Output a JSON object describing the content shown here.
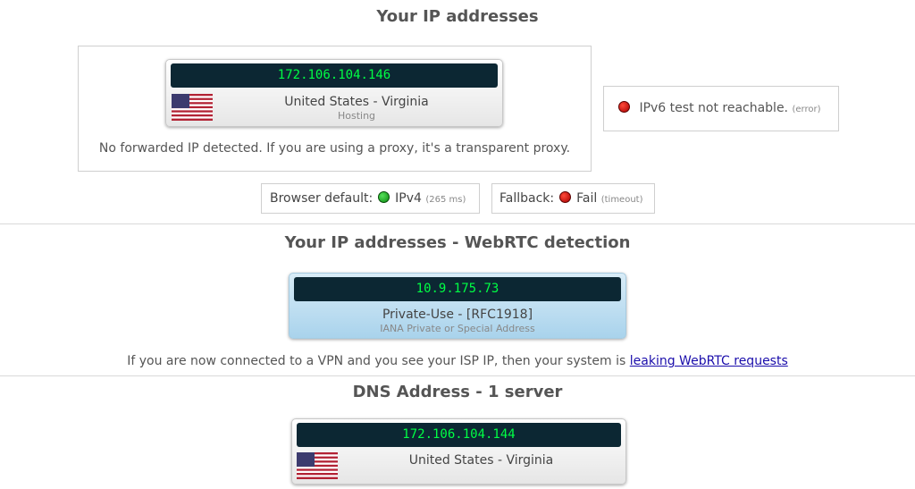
{
  "ip_section": {
    "title": "Your IP addresses",
    "ip": "172.106.104.146",
    "location": "United States - Virginia",
    "type": "Hosting",
    "forward_note": "No forwarded IP detected. If you are using a proxy, it's a transparent proxy.",
    "ipv6": {
      "text": "IPv6 test not reachable.",
      "detail": "(error)",
      "status_color": "#cc0000"
    },
    "browser_default": {
      "label": "Browser default:",
      "value": "IPv4",
      "detail": "(265 ms)",
      "status_color": "#11aa11"
    },
    "fallback": {
      "label": "Fallback:",
      "value": "Fail",
      "detail": "(timeout)",
      "status_color": "#cc0000"
    }
  },
  "webrtc_section": {
    "title": "Your IP addresses - WebRTC detection",
    "ip": "10.9.175.73",
    "location": "Private-Use - [RFC1918]",
    "type": "IANA Private or Special Address",
    "note_text": "If you are now connected to a VPN and you see your ISP IP, then your system is",
    "note_link": "leaking WebRTC requests"
  },
  "dns_section": {
    "title": "DNS Address - 1 server",
    "ip": "172.106.104.144",
    "location": "United States - Virginia"
  },
  "icons": [
    "us-flag-icon",
    "status-dot-icon"
  ]
}
